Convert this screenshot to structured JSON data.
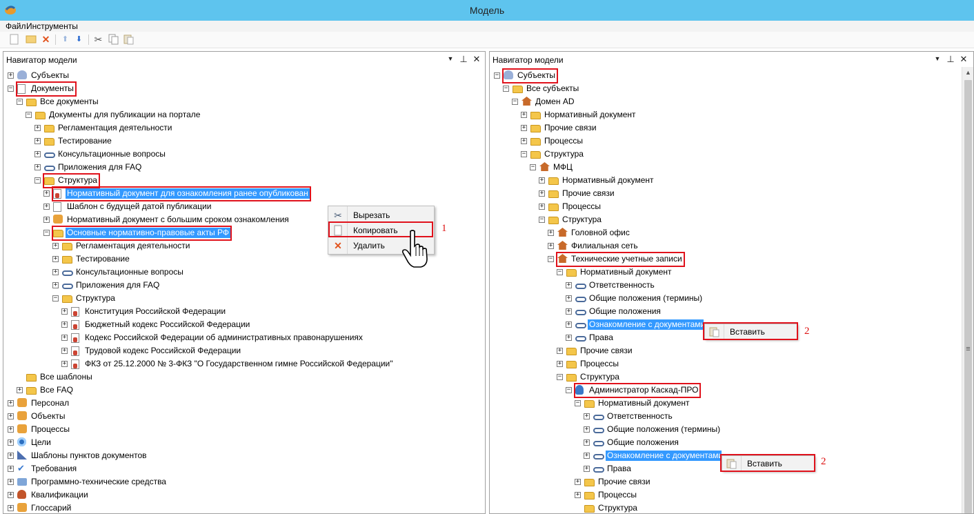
{
  "window": {
    "title": "Модель"
  },
  "menu": {
    "file": "Файл",
    "tools": "Инструменты"
  },
  "toolbar": {
    "icons": [
      "new-icon",
      "open-icon",
      "delete-icon",
      "move-up-icon",
      "move-down-icon",
      "cut-icon",
      "copy-icon",
      "paste-icon"
    ]
  },
  "left_panel": {
    "title": "Навигатор модели",
    "nodes": [
      {
        "label": "Субъекты",
        "icon": "people",
        "exp": "+"
      },
      {
        "label": "Документы",
        "icon": "doc",
        "exp": "-"
      },
      {
        "label": "Все документы",
        "icon": "folder",
        "exp": "-"
      },
      {
        "label": "Документы для публикации на портале",
        "icon": "folder",
        "exp": "-"
      },
      {
        "label": "Регламентация деятельности",
        "icon": "folder",
        "exp": "+"
      },
      {
        "label": "Тестирование",
        "icon": "folder",
        "exp": "+"
      },
      {
        "label": "Консультационные вопросы",
        "icon": "link",
        "exp": "+"
      },
      {
        "label": "Приложения для FAQ",
        "icon": "link",
        "exp": "+"
      },
      {
        "label": "Структура",
        "icon": "folder",
        "exp": "-"
      },
      {
        "label": "Нормативный документ для ознакомления ранее опубликован",
        "icon": "docred",
        "exp": "+"
      },
      {
        "label": "Шаблон с будущей датой публикации",
        "icon": "doc",
        "exp": "+"
      },
      {
        "label": "Нормативный документ с большим сроком ознакомления",
        "icon": "generic",
        "exp": "+"
      },
      {
        "label": "Основные нормативно-правовые акты РФ",
        "icon": "folder",
        "exp": "-"
      },
      {
        "label": "Регламентация деятельности",
        "icon": "folder",
        "exp": "+"
      },
      {
        "label": "Тестирование",
        "icon": "folder",
        "exp": "+"
      },
      {
        "label": "Консультационные вопросы",
        "icon": "link",
        "exp": "+"
      },
      {
        "label": "Приложения для FAQ",
        "icon": "link",
        "exp": "+"
      },
      {
        "label": "Структура",
        "icon": "folder",
        "exp": "-"
      },
      {
        "label": "Конституция Российской Федерации",
        "icon": "docred",
        "exp": "+"
      },
      {
        "label": "Бюджетный кодекс Российской Федерации",
        "icon": "docred",
        "exp": "+"
      },
      {
        "label": "Кодекс Российской Федерации об административных правонарушениях",
        "icon": "docred",
        "exp": "+"
      },
      {
        "label": "Трудовой кодекс Российской Федерации",
        "icon": "docred",
        "exp": "+"
      },
      {
        "label": "ФКЗ от 25.12.2000 № 3-ФКЗ \"О Государственном гимне Российской Федерации\"",
        "icon": "docred",
        "exp": "+"
      },
      {
        "label": "Все шаблоны",
        "icon": "folder",
        "exp": ""
      },
      {
        "label": "Все FAQ",
        "icon": "folder",
        "exp": "+"
      },
      {
        "label": "Персонал",
        "icon": "generic",
        "exp": "+"
      },
      {
        "label": "Объекты",
        "icon": "generic",
        "exp": "+"
      },
      {
        "label": "Процессы",
        "icon": "generic",
        "exp": "+"
      },
      {
        "label": "Цели",
        "icon": "target",
        "exp": "+"
      },
      {
        "label": "Шаблоны пунктов документов",
        "icon": "tmpl",
        "exp": "+"
      },
      {
        "label": "Требования",
        "icon": "check",
        "exp": "+"
      },
      {
        "label": "Программно-технические средства",
        "icon": "pc",
        "exp": "+"
      },
      {
        "label": "Квалификации",
        "icon": "person",
        "exp": "+"
      },
      {
        "label": "Глоссарий",
        "icon": "generic",
        "exp": "+"
      }
    ]
  },
  "context_menu_1": {
    "items": [
      "Вырезать",
      "Копировать",
      "Удалить"
    ],
    "marker": "1"
  },
  "right_panel": {
    "title": "Навигатор модели",
    "nodes": [
      {
        "label": "Субъекты",
        "icon": "people",
        "exp": "-"
      },
      {
        "label": "Все субъекты",
        "icon": "folder",
        "exp": "-"
      },
      {
        "label": "Домен AD",
        "icon": "house",
        "exp": "-"
      },
      {
        "label": "Нормативный документ",
        "icon": "folder",
        "exp": "+"
      },
      {
        "label": "Прочие связи",
        "icon": "folder",
        "exp": "+"
      },
      {
        "label": "Процессы",
        "icon": "folder",
        "exp": "+"
      },
      {
        "label": "Структура",
        "icon": "folder",
        "exp": "-"
      },
      {
        "label": "МФЦ",
        "icon": "house",
        "exp": "-"
      },
      {
        "label": "Нормативный документ",
        "icon": "folder",
        "exp": "+"
      },
      {
        "label": "Прочие связи",
        "icon": "folder",
        "exp": "+"
      },
      {
        "label": "Процессы",
        "icon": "folder",
        "exp": "+"
      },
      {
        "label": "Структура",
        "icon": "folder",
        "exp": "-"
      },
      {
        "label": "Головной офис",
        "icon": "house",
        "exp": "+"
      },
      {
        "label": "Филиальная сеть",
        "icon": "house",
        "exp": "+"
      },
      {
        "label": "Технические учетные записи",
        "icon": "house",
        "exp": "-"
      },
      {
        "label": "Нормативный документ",
        "icon": "folder",
        "exp": "-"
      },
      {
        "label": "Ответственность",
        "icon": "link",
        "exp": "+"
      },
      {
        "label": "Общие положения (термины)",
        "icon": "link",
        "exp": "+"
      },
      {
        "label": "Общие положения",
        "icon": "link",
        "exp": "+"
      },
      {
        "label": "Ознакомление с документами",
        "icon": "link",
        "exp": "+"
      },
      {
        "label": "Права",
        "icon": "link",
        "exp": "+"
      },
      {
        "label": "Прочие связи",
        "icon": "folder",
        "exp": "+"
      },
      {
        "label": "Процессы",
        "icon": "folder",
        "exp": "+"
      },
      {
        "label": "Структура",
        "icon": "folder",
        "exp": "-"
      },
      {
        "label": "Администратор Каскад-ПРО",
        "icon": "user",
        "exp": "-"
      },
      {
        "label": "Нормативный документ",
        "icon": "folder",
        "exp": "-"
      },
      {
        "label": "Ответственность",
        "icon": "link",
        "exp": "+"
      },
      {
        "label": "Общие положения (термины)",
        "icon": "link",
        "exp": "+"
      },
      {
        "label": "Общие положения",
        "icon": "link",
        "exp": "+"
      },
      {
        "label": "Ознакомление с документами",
        "icon": "link",
        "exp": "+"
      },
      {
        "label": "Права",
        "icon": "link",
        "exp": "+"
      },
      {
        "label": "Прочие связи",
        "icon": "folder",
        "exp": "+"
      },
      {
        "label": "Процессы",
        "icon": "folder",
        "exp": "+"
      },
      {
        "label": "Структура",
        "icon": "folder",
        "exp": ""
      }
    ]
  },
  "context_menu_2": {
    "paste": "Вставить",
    "marker": "2"
  },
  "context_menu_3": {
    "paste": "Вставить",
    "marker": "2"
  },
  "colors": {
    "titlebar": "#5ec4ee",
    "selection": "#3399ff",
    "highlight_box": "#e0111b"
  }
}
